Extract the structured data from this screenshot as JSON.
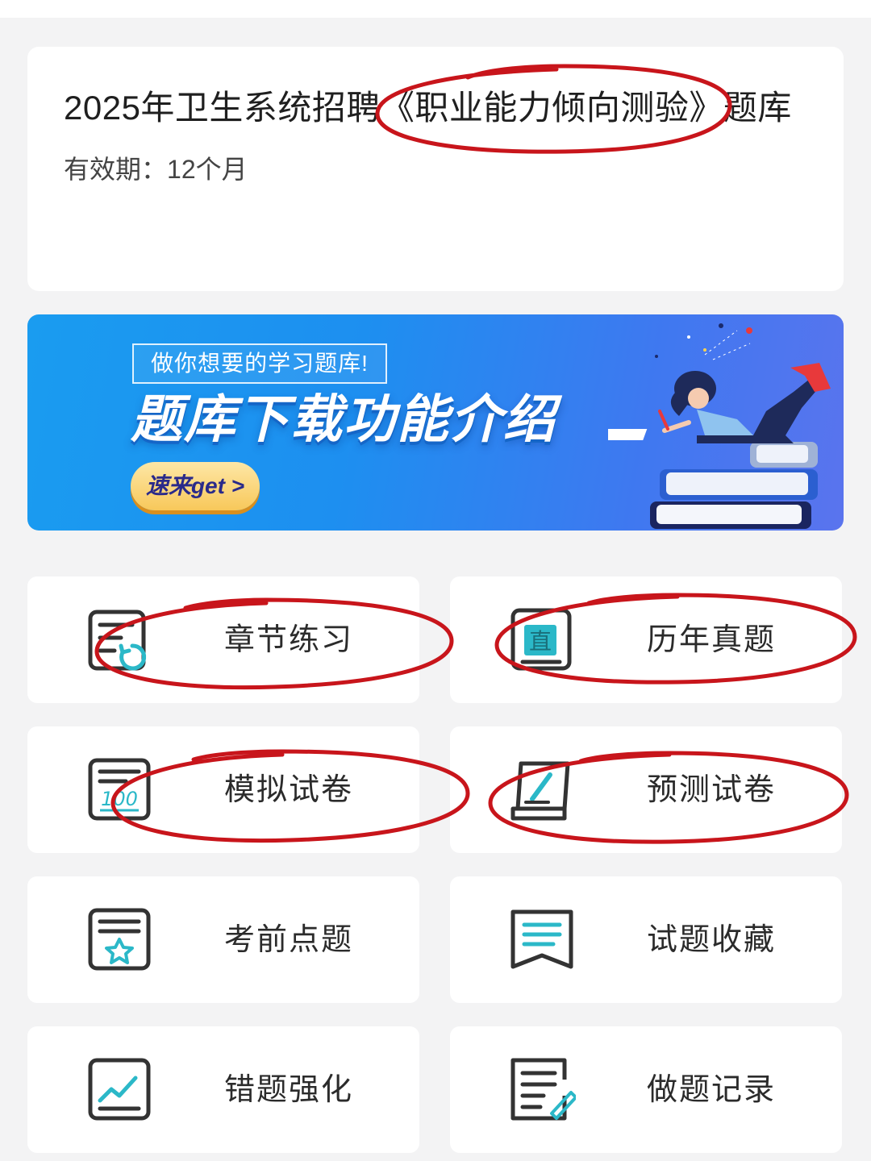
{
  "course": {
    "title": "2025年卫生系统招聘《职业能力倾向测验》题库",
    "validity_label": "有效期：",
    "validity_value": "12个月"
  },
  "banner": {
    "tagline": "做你想要的学习题库!",
    "headline": "题库下载功能介绍",
    "cta": "速来get >"
  },
  "menu": [
    {
      "label": "章节练习",
      "icon": "chapter-practice-icon"
    },
    {
      "label": "历年真题",
      "icon": "past-exam-icon"
    },
    {
      "label": "模拟试卷",
      "icon": "mock-exam-icon"
    },
    {
      "label": "预测试卷",
      "icon": "prediction-exam-icon"
    },
    {
      "label": "考前点题",
      "icon": "pre-exam-tips-icon"
    },
    {
      "label": "试题收藏",
      "icon": "favorites-icon"
    },
    {
      "label": "错题强化",
      "icon": "mistake-review-icon"
    },
    {
      "label": "做题记录",
      "icon": "practice-record-icon"
    }
  ],
  "colors": {
    "accent": "#2bb8c8",
    "annotation": "#c8151b",
    "banner_blue": "#1d8ff0",
    "cta_yellow": "#f8c85a"
  }
}
